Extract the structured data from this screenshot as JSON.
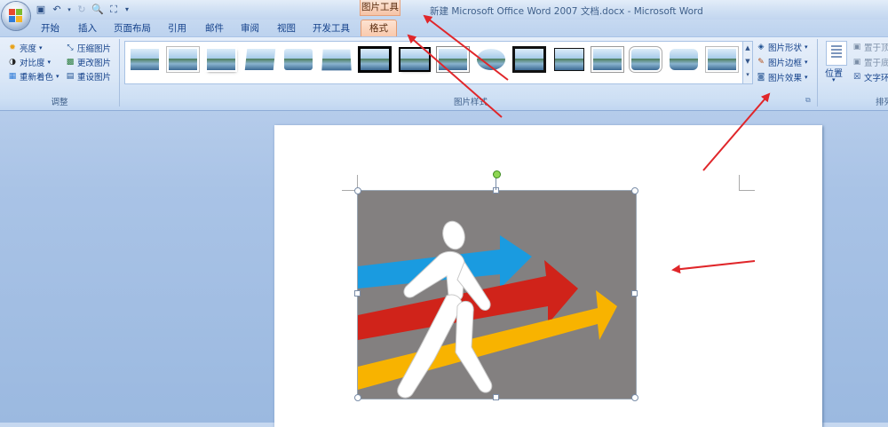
{
  "window": {
    "title": "新建 Microsoft Office Word 2007 文档.docx - Microsoft Word",
    "contextual_tab_group": "图片工具"
  },
  "quick_access": {
    "items": [
      "save-icon",
      "undo-icon",
      "dropdown-icon",
      "redo-icon",
      "print-preview-icon",
      "select-icon",
      "customize-icon"
    ]
  },
  "tabs": [
    {
      "label": "开始"
    },
    {
      "label": "插入"
    },
    {
      "label": "页面布局"
    },
    {
      "label": "引用"
    },
    {
      "label": "邮件"
    },
    {
      "label": "审阅"
    },
    {
      "label": "视图"
    },
    {
      "label": "开发工具"
    },
    {
      "label": "格式",
      "active": true
    }
  ],
  "groups": {
    "adjust": {
      "label": "调整",
      "buttons": {
        "brightness": "亮度",
        "contrast": "对比度",
        "recolor": "重新着色",
        "compress": "压缩图片",
        "change_picture": "更改图片",
        "reset_picture": "重设图片"
      }
    },
    "picture_styles": {
      "label": "图片样式",
      "gallery_count": 16,
      "buttons": {
        "picture_shape": "图片形状",
        "picture_border": "图片边框",
        "picture_effects": "图片效果"
      }
    },
    "arrange": {
      "label": "排列",
      "buttons": {
        "position": "位置",
        "bring_front": "置于顶",
        "send_back": "置于底",
        "text_wrap": "文字环"
      }
    }
  },
  "colors": {
    "ribbon": "#dae7f7",
    "active_tab": "#f9c8ab",
    "picture_background": "#838080",
    "arrow_blue": "#1a9be0",
    "arrow_red": "#d0231a",
    "arrow_yellow": "#f8b300",
    "annotation_arrow": "#e0262a"
  }
}
